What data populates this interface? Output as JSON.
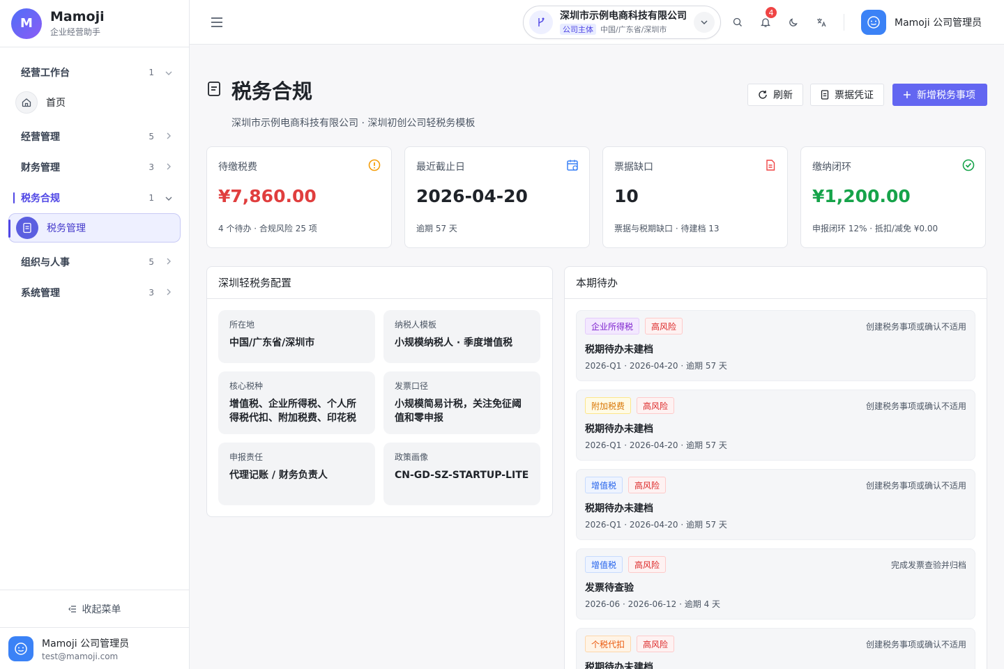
{
  "app": {
    "logo_letter": "M",
    "name": "Mamoji",
    "subtitle": "企业经营助手"
  },
  "sidebar": {
    "groups": [
      {
        "label": "经营工作台",
        "count": "1",
        "expanded": true
      },
      {
        "label": "经营管理",
        "count": "5",
        "expanded": false
      },
      {
        "label": "财务管理",
        "count": "3",
        "expanded": false
      },
      {
        "label": "税务合规",
        "count": "1",
        "expanded": true,
        "active": true
      },
      {
        "label": "组织与人事",
        "count": "5",
        "expanded": false
      },
      {
        "label": "系统管理",
        "count": "3",
        "expanded": false
      }
    ],
    "items": [
      {
        "label": "首页",
        "icon": "home-icon"
      },
      {
        "label": "税务管理",
        "icon": "document-icon",
        "selected": true
      }
    ],
    "collapse_label": "收起菜单",
    "user": {
      "name": "Mamoji 公司管理员",
      "email": "test@mamoji.com"
    }
  },
  "topbar": {
    "company": {
      "name": "深圳市示例电商科技有限公司",
      "tag": "公司主体",
      "region": "中国/广东省/深圳市"
    },
    "notification_count": "4",
    "user_name": "Mamoji 公司管理员"
  },
  "page": {
    "title": "税务合规",
    "subtitle": "深圳市示例电商科技有限公司 · 深圳初创公司轻税务模板",
    "buttons": {
      "refresh": "刷新",
      "voucher": "票据凭证",
      "add": "新增税务事项"
    }
  },
  "kpis": [
    {
      "title": "待缴税费",
      "value": "¥7,860.00",
      "sub": "4 个待办 · 合规风险 25 项",
      "color": "#e03e3e",
      "icon": "alert-circle-icon"
    },
    {
      "title": "最近截止日",
      "value": "2026-04-20",
      "sub": "逾期 57 天",
      "color": "#1f2329",
      "icon": "calendar-icon"
    },
    {
      "title": "票据缺口",
      "value": "10",
      "sub": "票据与税期缺口 · 待建档 13",
      "color": "#1f2329",
      "icon": "file-icon"
    },
    {
      "title": "缴纳闭环",
      "value": "¥1,200.00",
      "sub": "申报闭环 12% · 抵扣/减免 ¥0.00",
      "color": "#16a34a",
      "icon": "check-circle-icon"
    }
  ],
  "config_panel": {
    "title": "深圳轻税务配置",
    "items": [
      {
        "label": "所在地",
        "value": "中国/广东省/深圳市"
      },
      {
        "label": "纳税人模板",
        "value": "小规模纳税人 · 季度增值税"
      },
      {
        "label": "核心税种",
        "value": "增值税、企业所得税、个人所得税代扣、附加税费、印花税"
      },
      {
        "label": "发票口径",
        "value": "小规模简易计税，关注免征阈值和零申报"
      },
      {
        "label": "申报责任",
        "value": "代理记账 / 财务负责人"
      },
      {
        "label": "政策画像",
        "value": "CN-GD-SZ-STARTUP-LITE"
      }
    ]
  },
  "todo_panel": {
    "title": "本期待办",
    "items": [
      {
        "tag": "企业所得税",
        "tag_style": "purple",
        "risk": "高风险",
        "action": "创建税务事项或确认不适用",
        "title": "税期待办未建档",
        "meta": "2026-Q1 · 2026-04-20 · 逾期 57 天"
      },
      {
        "tag": "附加税费",
        "tag_style": "yellow",
        "risk": "高风险",
        "action": "创建税务事项或确认不适用",
        "title": "税期待办未建档",
        "meta": "2026-Q1 · 2026-04-20 · 逾期 57 天"
      },
      {
        "tag": "增值税",
        "tag_style": "blue",
        "risk": "高风险",
        "action": "创建税务事项或确认不适用",
        "title": "税期待办未建档",
        "meta": "2026-Q1 · 2026-04-20 · 逾期 57 天"
      },
      {
        "tag": "增值税",
        "tag_style": "blue",
        "risk": "高风险",
        "action": "完成发票查验并归档",
        "title": "发票待查验",
        "meta": "2026-06 · 2026-06-12 · 逾期 4 天"
      },
      {
        "tag": "个税代扣",
        "tag_style": "orange",
        "risk": "高风险",
        "action": "创建税务事项或确认不适用",
        "title": "税期待办未建档",
        "meta": ""
      }
    ]
  }
}
